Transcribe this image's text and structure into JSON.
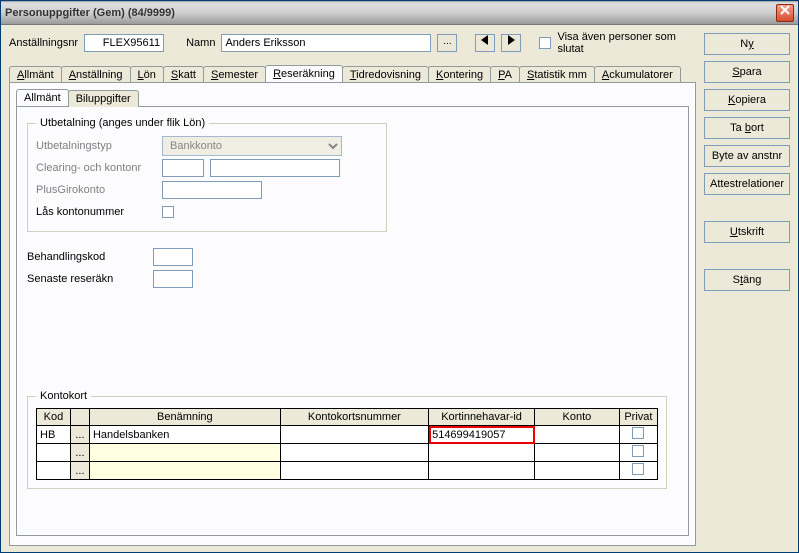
{
  "window": {
    "title": "Personuppgifter (Gem) (84/9999)"
  },
  "header": {
    "anst_label": "Anställningsnr",
    "anst_value": "FLEX95611",
    "namn_label": "Namn",
    "namn_value": "Anders Eriksson",
    "visa_slutat_label": "Visa även personer som slutat"
  },
  "side": {
    "ny": "Ny",
    "spara": "Spara",
    "kopiera": "Kopiera",
    "tabort": "Ta bort",
    "byte": "Byte av anstnr",
    "attest": "Attestrelationer",
    "utskrift": "Utskrift",
    "stang": "Stäng"
  },
  "tabs": [
    "Allmänt",
    "Anställning",
    "Lön",
    "Skatt",
    "Semester",
    "Reseräkning",
    "Tidredovisning",
    "Kontering",
    "PA",
    "Statistik mm",
    "Ackumulatorer"
  ],
  "active_tab": 5,
  "subtabs": [
    "Allmänt",
    "Biluppgifter"
  ],
  "active_subtab": 0,
  "utbet": {
    "legend": "Utbetalning (anges under flik Lön)",
    "typ_label": "Utbetalningstyp",
    "typ_value": "Bankkonto",
    "clearing_label": "Clearing- och kontonr",
    "plusgiro_label": "PlusGirokonto",
    "las_label": "Lås kontonummer"
  },
  "beh": {
    "kod_label": "Behandlingskod",
    "senaste_label": "Senaste reseräkn"
  },
  "kontokort": {
    "legend": "Kontokort",
    "headers": [
      "Kod",
      "",
      "Benämning",
      "Kontokortsnummer",
      "Kortinnehavar-id",
      "Konto",
      "Privat"
    ],
    "rows": [
      {
        "kod": "HB",
        "benamning": "Handelsbanken",
        "nummer": "",
        "innehavar": "514699419057",
        "konto": "",
        "privat": false
      },
      {
        "kod": "",
        "benamning": "",
        "nummer": "",
        "innehavar": "",
        "konto": "",
        "privat": false
      },
      {
        "kod": "",
        "benamning": "",
        "nummer": "",
        "innehavar": "",
        "konto": "",
        "privat": false
      }
    ]
  }
}
